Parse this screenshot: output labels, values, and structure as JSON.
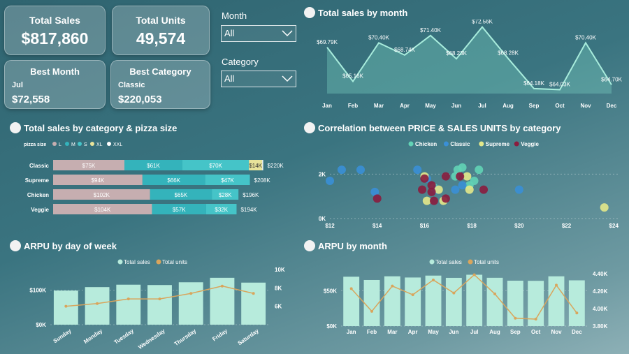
{
  "kpis": {
    "total_sales": {
      "label": "Total Sales",
      "value": "$817,860"
    },
    "total_units": {
      "label": "Total Units",
      "value": "49,574"
    },
    "best_month": {
      "label": "Best Month",
      "sub": "Jul",
      "value": "$72,558"
    },
    "best_category": {
      "label": "Best Category",
      "sub": "Classic",
      "value": "$220,053"
    }
  },
  "filters": {
    "month": {
      "label": "Month",
      "value": "All"
    },
    "category": {
      "label": "Category",
      "value": "All"
    }
  },
  "colors": {
    "accent": "#7fd8c5",
    "pink": "#c6aeb0",
    "teal": "#34b3bb",
    "teal2": "#45c4c8",
    "cream": "#e8e49a",
    "navy": "#1a3a5c",
    "blue": "#3a8fd6",
    "maroon": "#8a1c3e",
    "green": "#62d3b5",
    "yellow": "#e3e88a",
    "line": "#d9a55c"
  },
  "charts": {
    "sales_by_month": {
      "title": "Total sales by month",
      "chart_data": {
        "type": "area",
        "categories": [
          "Jan",
          "Feb",
          "Mar",
          "Apr",
          "May",
          "Jun",
          "Jul",
          "Aug",
          "Sep",
          "Oct",
          "Nov",
          "Dec"
        ],
        "values": [
          69.79,
          65.16,
          70.4,
          68.74,
          71.4,
          68.23,
          72.56,
          68.28,
          64.18,
          64.03,
          70.4,
          64.7
        ],
        "labels": [
          "$69.79K",
          "$65.16K",
          "$70.40K",
          "$68.74K",
          "$71.40K",
          "$68.23K",
          "$72.56K",
          "$68.28K",
          "$64.18K",
          "$64.03K",
          "$70.40K",
          "$64.70K"
        ],
        "ylim": [
          63.5,
          73
        ]
      }
    },
    "category_size": {
      "title": "Total sales by category & pizza size",
      "legend_title": "pizza size",
      "chart_data": {
        "type": "bar",
        "sizes": [
          "L",
          "M",
          "S",
          "XL",
          "XXL"
        ],
        "categories": [
          "Classic",
          "Supreme",
          "Chicken",
          "Veggie"
        ],
        "series": [
          {
            "name": "L",
            "values": [
              75,
              94,
              102,
              104
            ],
            "labels": [
              "$75K",
              "$94K",
              "$102K",
              "$104K"
            ]
          },
          {
            "name": "M",
            "values": [
              61,
              66,
              65,
              57
            ],
            "labels": [
              "$61K",
              "$66K",
              "$65K",
              "$57K"
            ]
          },
          {
            "name": "S",
            "values": [
              70,
              47,
              28,
              32
            ],
            "labels": [
              "$70K",
              "$47K",
              "$28K",
              "$32K"
            ]
          },
          {
            "name": "XL",
            "values": [
              14,
              0,
              0,
              0
            ],
            "labels": [
              "$14K",
              "",
              "",
              ""
            ]
          },
          {
            "name": "XXL",
            "values": [
              1,
              0,
              0,
              0
            ],
            "labels": [
              "",
              "",
              "",
              ""
            ]
          }
        ],
        "totals": [
          "$220K",
          "$208K",
          "$196K",
          "$194K"
        ]
      }
    },
    "correlation": {
      "title": "Correlation between PRICE & SALES UNITS by category",
      "chart_data": {
        "type": "scatter",
        "series": [
          {
            "name": "Chicken",
            "points": [
              [
                17.4,
                2.2
              ],
              [
                17.6,
                2.3
              ],
              [
                18.3,
                2.2
              ],
              [
                18.1,
                1.7
              ],
              [
                17.9,
                1.5
              ],
              [
                16.4,
                1.4
              ],
              [
                17.3,
                1.9
              ]
            ]
          },
          {
            "name": "Classic",
            "points": [
              [
                12.0,
                1.7
              ],
              [
                12.5,
                2.2
              ],
              [
                13.3,
                2.2
              ],
              [
                15.7,
                2.2
              ],
              [
                13.9,
                1.2
              ],
              [
                16.5,
                1.3
              ],
              [
                17.3,
                1.3
              ],
              [
                17.6,
                1.5
              ],
              [
                20.0,
                1.3
              ],
              [
                16.1,
                1.8
              ]
            ]
          },
          {
            "name": "Supreme",
            "points": [
              [
                16.0,
                1.9
              ],
              [
                16.6,
                1.3
              ],
              [
                17.8,
                1.9
              ],
              [
                17.9,
                1.3
              ],
              [
                16.1,
                0.8
              ],
              [
                16.8,
                0.8
              ],
              [
                23.6,
                0.5
              ]
            ]
          },
          {
            "name": "Veggie",
            "points": [
              [
                15.9,
                1.3
              ],
              [
                16.3,
                1.5
              ],
              [
                16.3,
                1.2
              ],
              [
                16.9,
                1.9
              ],
              [
                17.5,
                1.9
              ],
              [
                18.5,
                1.3
              ],
              [
                16.4,
                0.8
              ],
              [
                14.0,
                0.9
              ],
              [
                16.0,
                1.8
              ],
              [
                16.9,
                0.9
              ]
            ]
          }
        ],
        "xticks": [
          "$12",
          "$14",
          "$16",
          "$18",
          "$20",
          "$22",
          "$24"
        ],
        "yticks": [
          "0K",
          "2K"
        ],
        "xlim": [
          12,
          24.2
        ],
        "ylim": [
          0,
          2.8
        ]
      }
    },
    "arpu_day": {
      "title": "ARPU by day of week",
      "legend": [
        "Total sales",
        "Total units"
      ],
      "chart_data": {
        "type": "bar",
        "categories": [
          "Sunday",
          "Monday",
          "Tuesday",
          "Wednesday",
          "Thursday",
          "Friday",
          "Saturday"
        ],
        "series": [
          {
            "name": "Total sales",
            "values": [
              99,
              109,
              116,
              115,
              123,
              136,
              122
            ]
          },
          {
            "name": "Total units",
            "values": [
              6.0,
              6.3,
              6.8,
              6.8,
              7.4,
              8.2,
              7.4
            ]
          }
        ],
        "yticks_left": [
          "$0K",
          "$100K"
        ],
        "yticks_right": [
          "6K",
          "8K",
          "10K"
        ],
        "ylim_left": [
          0,
          160
        ],
        "ylim_right": [
          4,
          10
        ]
      }
    },
    "arpu_month": {
      "title": "ARPU by month",
      "legend": [
        "Total sales",
        "Total units"
      ],
      "chart_data": {
        "type": "bar",
        "categories": [
          "Jan",
          "Feb",
          "Mar",
          "Apr",
          "May",
          "Jun",
          "Jul",
          "Aug",
          "Sep",
          "Oct",
          "Nov",
          "Dec"
        ],
        "series": [
          {
            "name": "Total sales",
            "values": [
              69.8,
              65.2,
              70.4,
              68.7,
              71.4,
              68.2,
              72.6,
              68.3,
              64.2,
              64.0,
              70.4,
              64.7
            ]
          },
          {
            "name": "Total units",
            "values": [
              4.23,
              3.97,
              4.26,
              4.16,
              4.33,
              4.18,
              4.39,
              4.17,
              3.89,
              3.88,
              4.27,
              3.95
            ]
          }
        ],
        "yticks_left": [
          "$0K",
          "$50K"
        ],
        "yticks_right": [
          "3.80K",
          "4.00K",
          "4.20K",
          "4.40K"
        ],
        "ylim_left": [
          0,
          80
        ],
        "ylim_right": [
          3.8,
          4.45
        ]
      }
    }
  }
}
